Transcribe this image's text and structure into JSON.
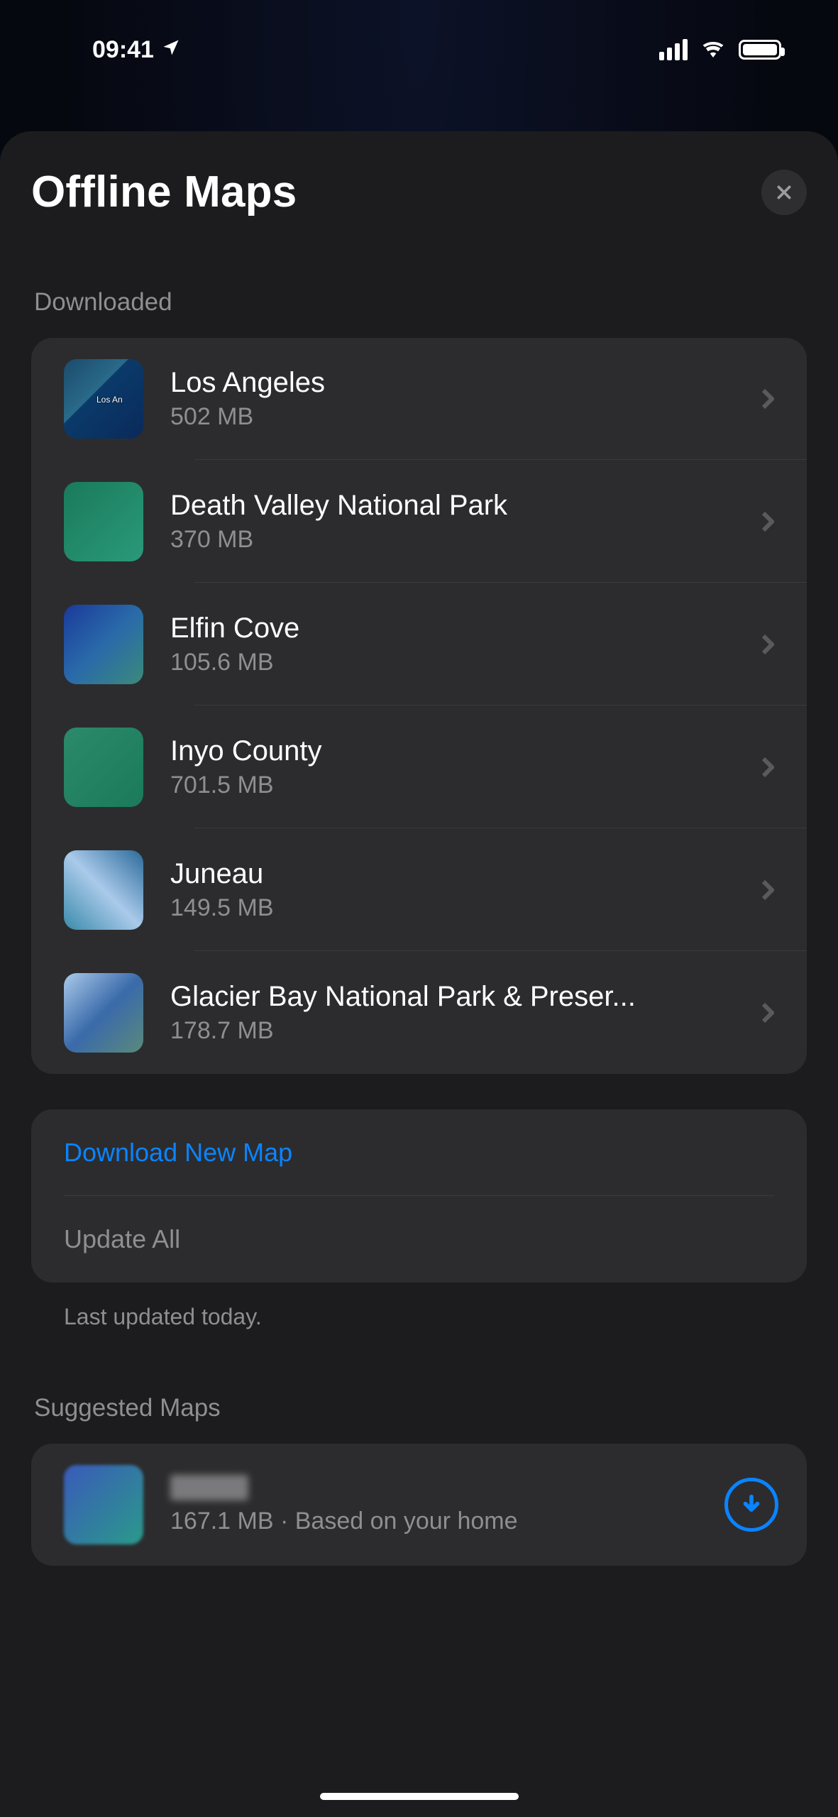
{
  "status": {
    "time": "09:41"
  },
  "header": {
    "title": "Offline Maps"
  },
  "sections": {
    "downloaded_label": "Downloaded",
    "suggested_label": "Suggested Maps"
  },
  "downloaded": [
    {
      "name": "Los Angeles",
      "size": "502 MB"
    },
    {
      "name": "Death Valley National Park",
      "size": "370 MB"
    },
    {
      "name": "Elfin Cove",
      "size": "105.6 MB"
    },
    {
      "name": "Inyo County",
      "size": "701.5 MB"
    },
    {
      "name": "Juneau",
      "size": "149.5 MB"
    },
    {
      "name": "Glacier Bay National Park & Preser...",
      "size": "178.7 MB"
    }
  ],
  "actions": {
    "download_new": "Download New Map",
    "update_all": "Update All"
  },
  "footnote": "Last updated today.",
  "suggested": [
    {
      "name": "",
      "sub": "167.1 MB · Based on your home"
    }
  ],
  "colors": {
    "accent": "#0a84ff",
    "bg": "#1c1c1e",
    "card": "#2c2c2e",
    "muted": "#8e8e93"
  }
}
